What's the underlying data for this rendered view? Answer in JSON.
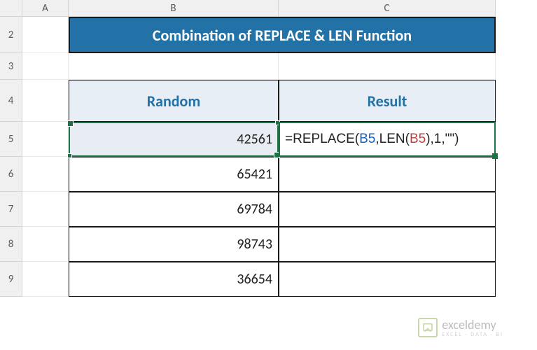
{
  "columns": [
    "A",
    "B",
    "C"
  ],
  "rows": [
    "2",
    "3",
    "4",
    "5",
    "6",
    "7",
    "8",
    "9"
  ],
  "title": "Combination of REPLACE & LEN Function",
  "headers": {
    "b": "Random",
    "c": "Result"
  },
  "data": {
    "b5": "42561",
    "b6": "65421",
    "b7": "69784",
    "b8": "98743",
    "b9": "36654"
  },
  "formula": {
    "prefix": "=REPLACE(",
    "ref1": "B5",
    "mid1": ",LEN(",
    "ref2": "B5",
    "mid2": "),1,\"\")"
  },
  "watermark": {
    "brand": "exceldemy",
    "tagline": "EXCEL · DATA · BI"
  },
  "chart_data": {
    "type": "table",
    "title": "Combination of REPLACE & LEN Function",
    "columns": [
      "Random",
      "Result"
    ],
    "rows": [
      {
        "Random": 42561,
        "Result": "=REPLACE(B5,LEN(B5),1,\"\")"
      },
      {
        "Random": 65421,
        "Result": ""
      },
      {
        "Random": 69784,
        "Result": ""
      },
      {
        "Random": 98743,
        "Result": ""
      },
      {
        "Random": 36654,
        "Result": ""
      }
    ]
  }
}
